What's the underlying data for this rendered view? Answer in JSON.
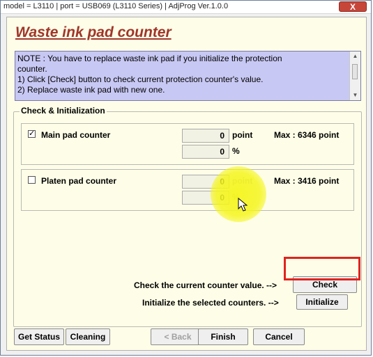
{
  "window": {
    "title": "model = L3110 | port = USB069 (L3110 Series) | AdjProg Ver.1.0.0",
    "close_label": "X"
  },
  "heading": "Waste ink pad counter",
  "note": {
    "lines": [
      "NOTE : You have to replace waste ink pad if you initialize the protection",
      "counter.",
      "1) Click [Check] button to check current protection counter's value.",
      "2) Replace waste ink pad with new one."
    ]
  },
  "group": {
    "label": "Check & Initialization",
    "counters": [
      {
        "label": "Main pad counter",
        "checked": true,
        "check_mark": "✓",
        "point_value": "0",
        "point_unit": "point",
        "percent_value": "0",
        "percent_unit": "%",
        "max": "Max : 6346 point"
      },
      {
        "label": "Platen pad counter",
        "checked": false,
        "check_mark": "",
        "point_value": "0",
        "point_unit": "point",
        "percent_value": "0",
        "percent_unit": "%",
        "max": "Max : 3416 point"
      }
    ]
  },
  "actions": {
    "check_label": "Check the current counter value. -->",
    "check_button": "Check",
    "initialize_label": "Initialize the selected counters. -->",
    "initialize_button": "Initialize"
  },
  "footer": {
    "get_status": "Get Status",
    "cleaning": "Cleaning",
    "back": "< Back",
    "finish": "Finish",
    "cancel": "Cancel"
  },
  "colors": {
    "heading": "#a0362a",
    "note_bg": "#c8c8f4",
    "highlight": "#e0231e",
    "spotlight": "#f5f51e"
  }
}
